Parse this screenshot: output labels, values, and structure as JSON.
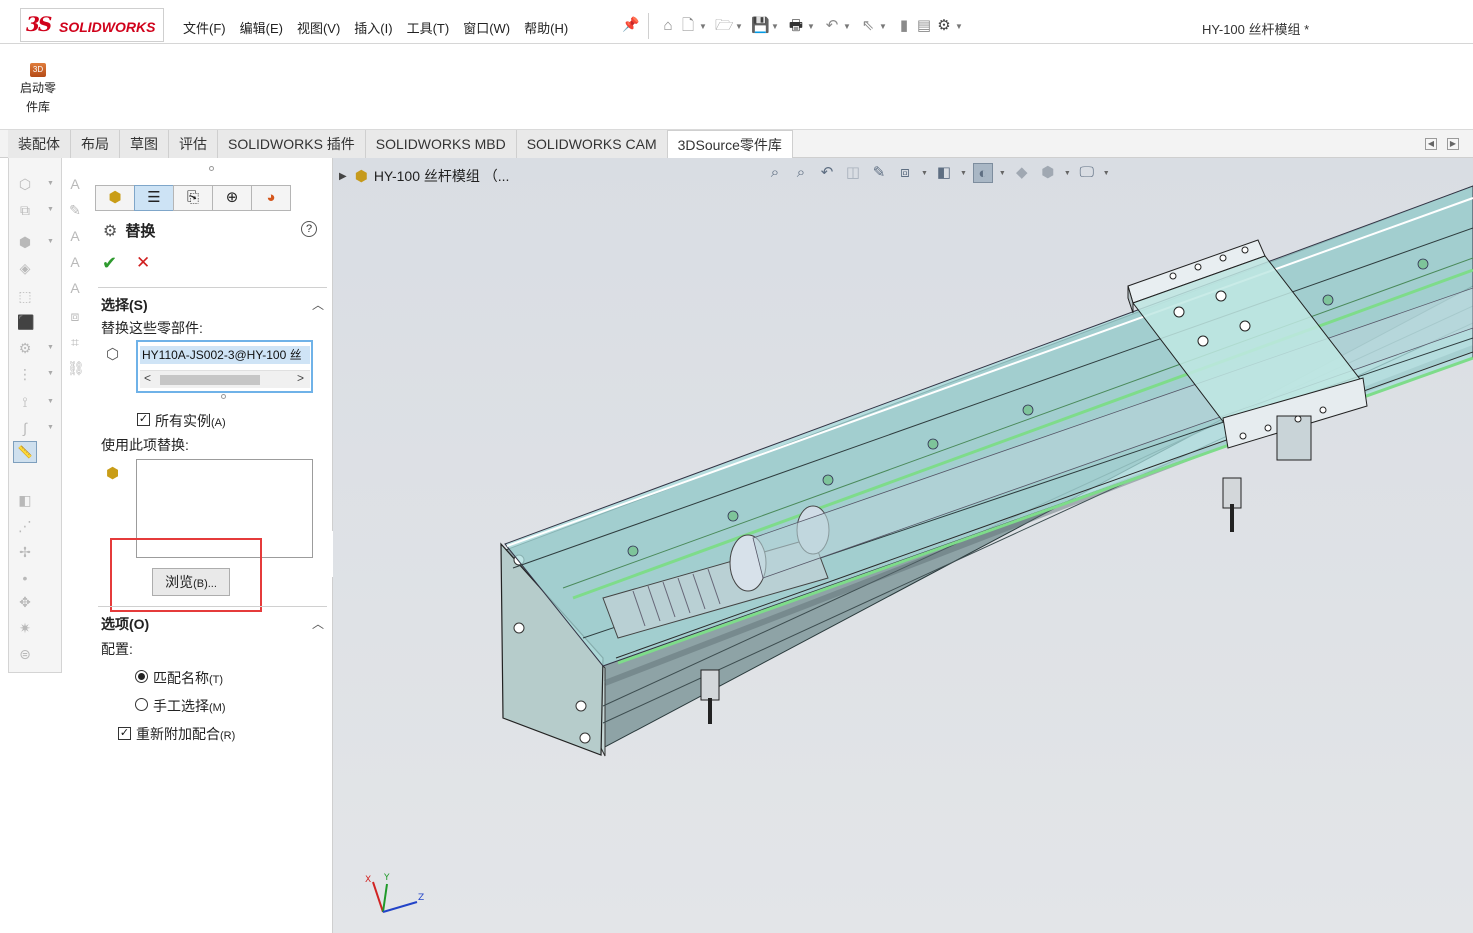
{
  "app": {
    "logo_ds": "3S",
    "logo_text": "SOLIDWORKS",
    "document_title": "HY-100 丝杆模组 *"
  },
  "menu": [
    "文件(F)",
    "编辑(E)",
    "视图(V)",
    "插入(I)",
    "工具(T)",
    "窗口(W)",
    "帮助(H)"
  ],
  "quick_access": [
    "home-icon",
    "new-file-icon",
    "open-icon",
    "save-icon",
    "print-icon",
    "undo-icon",
    "select-icon",
    "traffic-light-icon",
    "file-properties-icon",
    "options-gear-icon"
  ],
  "command_manager": {
    "library_button_line1": "启动零",
    "library_button_line2": "件库",
    "library_icon_text": "3D"
  },
  "tabs": [
    {
      "label": "装配体",
      "active": false
    },
    {
      "label": "布局",
      "active": false
    },
    {
      "label": "草图",
      "active": false
    },
    {
      "label": "评估",
      "active": false
    },
    {
      "label": "SOLIDWORKS 插件",
      "active": false
    },
    {
      "label": "SOLIDWORKS MBD",
      "active": false
    },
    {
      "label": "SOLIDWORKS CAM",
      "active": false
    },
    {
      "label": "3DSource零件库",
      "active": true
    }
  ],
  "property_manager": {
    "title": "替换",
    "help": "?",
    "ok_glyph": "✔",
    "cancel_glyph": "✕",
    "selection": {
      "header": "选择(S)",
      "replace_these_label": "替换这些零部件:",
      "selected_item": "HY110A-JS002-3@HY-100 丝",
      "all_instances_label": "所有实例",
      "all_instances_key": "(A)",
      "all_instances_checked": true,
      "replace_with_label": "使用此项替换:",
      "browse_label": "浏览",
      "browse_key": "(B)..."
    },
    "options": {
      "header": "选项(O)",
      "config_label": "配置:",
      "match_name_label": "匹配名称",
      "match_name_key": "(T)",
      "match_name_selected": true,
      "manual_select_label": "手工选择",
      "manual_select_key": "(M)",
      "manual_select_selected": false,
      "reattach_mates_label": "重新附加配合",
      "reattach_mates_key": "(R)",
      "reattach_mates_checked": true
    }
  },
  "viewport": {
    "tree_item": "HY-100 丝杆模组 （...",
    "triad": {
      "x": "X",
      "y": "Y",
      "z": "Z"
    }
  },
  "colors": {
    "highlight": "#e53b3b",
    "selection_fill": "#cfe4f6",
    "selection_border": "#6fb2e8",
    "ok": "#2e9a2e",
    "cancel": "#d01f1f",
    "model_glass": "#a8dcdc",
    "rail_green": "#7edc8a"
  }
}
